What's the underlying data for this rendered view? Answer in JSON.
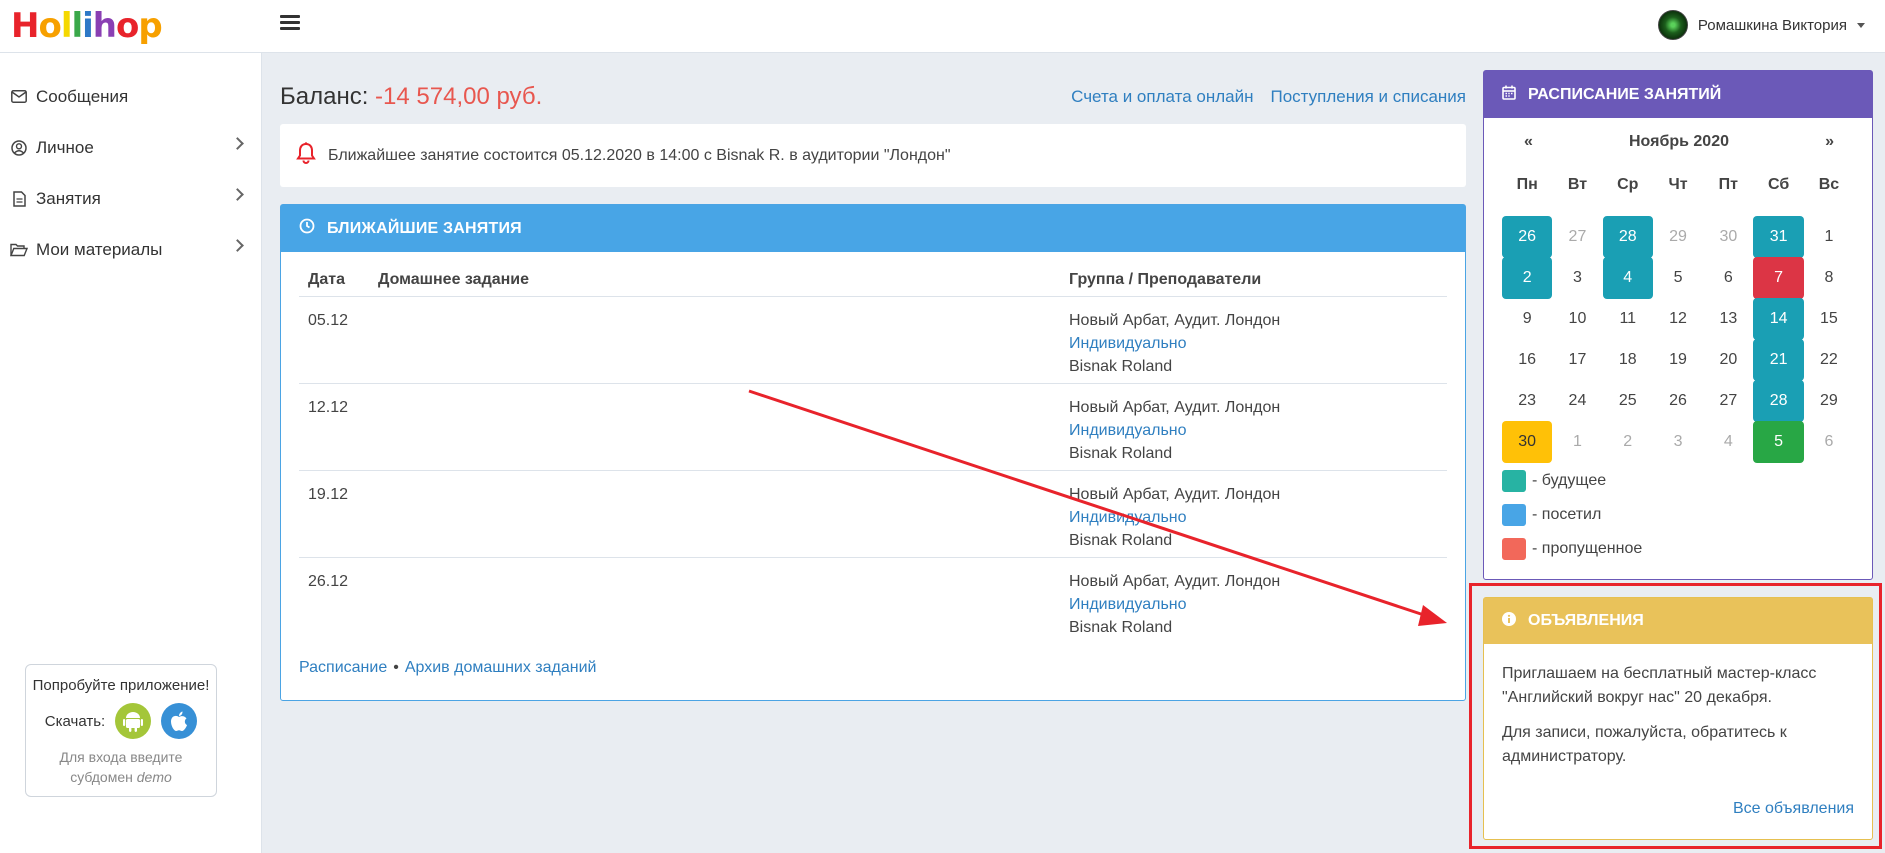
{
  "app": {
    "logo_text": "Hollihop",
    "logo_colors": [
      "#e8232b",
      "#f7a000",
      "#f5d800",
      "#3aa84a",
      "#2d79c7",
      "#8a3fb3",
      "#e8232b",
      "#f7a000"
    ]
  },
  "header": {
    "user_name": "Ромашкина Виктория"
  },
  "sidebar": {
    "items": [
      {
        "label": "Сообщения",
        "icon": "envelope-icon",
        "has_submenu": false
      },
      {
        "label": "Личное",
        "icon": "user-circle-icon",
        "has_submenu": true
      },
      {
        "label": "Занятия",
        "icon": "document-icon",
        "has_submenu": true
      },
      {
        "label": "Мои материалы",
        "icon": "folder-open-icon",
        "has_submenu": true
      }
    ],
    "promo": {
      "title": "Попробуйте приложение!",
      "download_label": "Скачать:",
      "hint_line1": "Для входа введите",
      "hint_line2_prefix": "субдомен ",
      "hint_line2_em": "demo"
    }
  },
  "balance": {
    "label": "Баланс:",
    "value": "-14 574,00 руб."
  },
  "links": {
    "invoices": "Счета и оплата онлайн",
    "transactions": "Поступления и списания"
  },
  "notice": {
    "text": "Ближайшее занятие состоится 05.12.2020 в 14:00 с Bisnak R. в аудитории \"Лондон\""
  },
  "lessons": {
    "title": "БЛИЖАЙШИЕ ЗАНЯТИЯ",
    "columns": [
      "Дата",
      "Домашнее задание",
      "Группа / Преподаватели"
    ],
    "rows": [
      {
        "date": "05.12",
        "homework": "",
        "location": "Новый Арбат, Аудит. Лондон",
        "group": "Индивидуально",
        "teacher": "Bisnak Roland"
      },
      {
        "date": "12.12",
        "homework": "",
        "location": "Новый Арбат, Аудит. Лондон",
        "group": "Индивидуально",
        "teacher": "Bisnak Roland"
      },
      {
        "date": "19.12",
        "homework": "",
        "location": "Новый Арбат, Аудит. Лондон",
        "group": "Индивидуально",
        "teacher": "Bisnak Roland"
      },
      {
        "date": "26.12",
        "homework": "",
        "location": "Новый Арбат, Аудит. Лондон",
        "group": "Индивидуально",
        "teacher": "Bisnak Roland"
      }
    ],
    "footer": {
      "schedule": "Расписание",
      "archive": "Архив домашних заданий"
    }
  },
  "calendar": {
    "title": "РАСПИСАНИЕ ЗАНЯТИЙ",
    "prev": "«",
    "next": "»",
    "month": "Ноябрь 2020",
    "weekdays": [
      "Пн",
      "Вт",
      "Ср",
      "Чт",
      "Пт",
      "Сб",
      "Вс"
    ],
    "weeks": [
      [
        {
          "d": "26",
          "s": "teal"
        },
        {
          "d": "27",
          "s": "muted"
        },
        {
          "d": "28",
          "s": "teal"
        },
        {
          "d": "29",
          "s": "muted"
        },
        {
          "d": "30",
          "s": "muted"
        },
        {
          "d": "31",
          "s": "teal"
        },
        {
          "d": "1",
          "s": ""
        }
      ],
      [
        {
          "d": "2",
          "s": "teal"
        },
        {
          "d": "3",
          "s": ""
        },
        {
          "d": "4",
          "s": "teal"
        },
        {
          "d": "5",
          "s": ""
        },
        {
          "d": "6",
          "s": ""
        },
        {
          "d": "7",
          "s": "red"
        },
        {
          "d": "8",
          "s": ""
        }
      ],
      [
        {
          "d": "9",
          "s": ""
        },
        {
          "d": "10",
          "s": ""
        },
        {
          "d": "11",
          "s": ""
        },
        {
          "d": "12",
          "s": ""
        },
        {
          "d": "13",
          "s": ""
        },
        {
          "d": "14",
          "s": "teal"
        },
        {
          "d": "15",
          "s": ""
        }
      ],
      [
        {
          "d": "16",
          "s": ""
        },
        {
          "d": "17",
          "s": ""
        },
        {
          "d": "18",
          "s": ""
        },
        {
          "d": "19",
          "s": ""
        },
        {
          "d": "20",
          "s": ""
        },
        {
          "d": "21",
          "s": "teal"
        },
        {
          "d": "22",
          "s": ""
        }
      ],
      [
        {
          "d": "23",
          "s": ""
        },
        {
          "d": "24",
          "s": ""
        },
        {
          "d": "25",
          "s": ""
        },
        {
          "d": "26",
          "s": ""
        },
        {
          "d": "27",
          "s": ""
        },
        {
          "d": "28",
          "s": "teal"
        },
        {
          "d": "29",
          "s": ""
        }
      ],
      [
        {
          "d": "30",
          "s": "yellow"
        },
        {
          "d": "1",
          "s": "muted"
        },
        {
          "d": "2",
          "s": "muted"
        },
        {
          "d": "3",
          "s": "muted"
        },
        {
          "d": "4",
          "s": "muted"
        },
        {
          "d": "5",
          "s": "green"
        },
        {
          "d": "6",
          "s": "muted"
        }
      ]
    ],
    "legend": [
      {
        "label": "- будущее",
        "color": "#27b3a3"
      },
      {
        "label": "- посетил",
        "color": "#48a5e6"
      },
      {
        "label": "- пропущенное",
        "color": "#f2685a"
      }
    ]
  },
  "announcements": {
    "title": "ОБЪЯВЛЕНИЯ",
    "paragraphs": [
      "Приглашаем на бесплатный мастер-класс \"Английский вокруг нас\" 20 декабря.",
      "Для записи, пожалуйста, обратитесь к администратору."
    ],
    "all_link": "Все объявления"
  },
  "colors": {
    "accent_blue": "#48a5e6",
    "calendar_purple": "#6b59b8",
    "announce_yellow": "#e9c25a",
    "annotation_red": "#e8232b",
    "negative_balance": "#e8574f"
  }
}
